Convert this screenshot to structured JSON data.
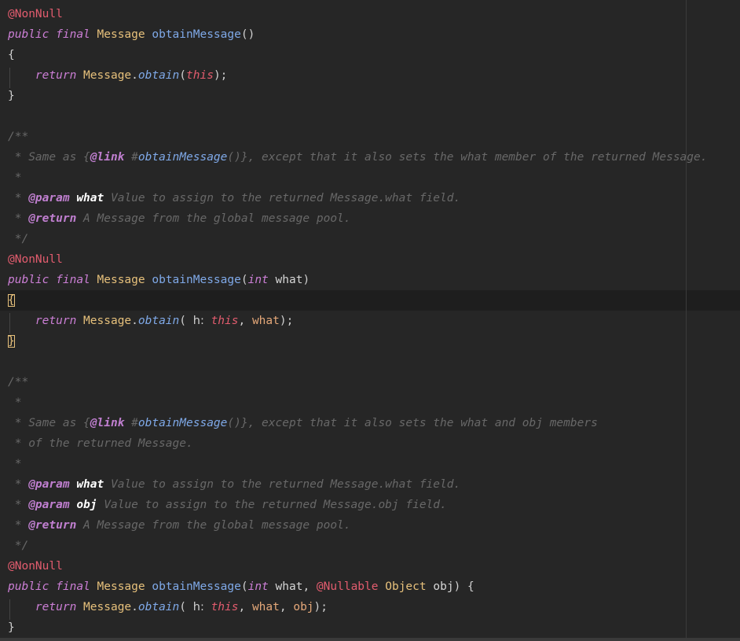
{
  "editor": {
    "lines": [
      [
        {
          "t": "@NonNull",
          "c": "annot"
        }
      ],
      [
        {
          "t": "public",
          "c": "kw"
        },
        {
          "t": " "
        },
        {
          "t": "final",
          "c": "kw"
        },
        {
          "t": " "
        },
        {
          "t": "Message",
          "c": "type"
        },
        {
          "t": " "
        },
        {
          "t": "obtainMessage",
          "c": "method"
        },
        {
          "t": "()",
          "c": "punc"
        }
      ],
      [
        {
          "t": "{",
          "c": "brace"
        }
      ],
      [
        {
          "t": "    "
        },
        {
          "t": "return",
          "c": "kw"
        },
        {
          "t": " "
        },
        {
          "t": "Message",
          "c": "type"
        },
        {
          "t": ".",
          "c": "punc"
        },
        {
          "t": "obtain",
          "c": "methodcall"
        },
        {
          "t": "(",
          "c": "punc"
        },
        {
          "t": "this",
          "c": "this"
        },
        {
          "t": ");",
          "c": "punc"
        }
      ],
      [
        {
          "t": "}",
          "c": "brace"
        }
      ],
      [],
      [
        {
          "t": "/**",
          "c": "comment"
        }
      ],
      [
        {
          "t": " * Same as {",
          "c": "comment"
        },
        {
          "t": "@link",
          "c": "doctag"
        },
        {
          "t": " #",
          "c": "comment"
        },
        {
          "t": "obtainMessage",
          "c": "doclink"
        },
        {
          "t": "()}, except that it also sets the what member of the returned Message.",
          "c": "comment"
        }
      ],
      [
        {
          "t": " *",
          "c": "comment"
        }
      ],
      [
        {
          "t": " * ",
          "c": "comment"
        },
        {
          "t": "@param",
          "c": "doctag"
        },
        {
          "t": " "
        },
        {
          "t": "what",
          "c": "docname"
        },
        {
          "t": " Value to assign to the returned Message.what field.",
          "c": "comment"
        }
      ],
      [
        {
          "t": " * ",
          "c": "comment"
        },
        {
          "t": "@return",
          "c": "doctag"
        },
        {
          "t": " A Message from the global message pool.",
          "c": "comment"
        }
      ],
      [
        {
          "t": " */",
          "c": "comment"
        }
      ],
      [
        {
          "t": "@NonNull",
          "c": "annot"
        }
      ],
      [
        {
          "t": "public",
          "c": "kw"
        },
        {
          "t": " "
        },
        {
          "t": "final",
          "c": "kw"
        },
        {
          "t": " "
        },
        {
          "t": "Message",
          "c": "type"
        },
        {
          "t": " "
        },
        {
          "t": "obtainMessage",
          "c": "method"
        },
        {
          "t": "(",
          "c": "punc"
        },
        {
          "t": "int",
          "c": "kw"
        },
        {
          "t": " "
        },
        {
          "t": "what",
          "c": "plain"
        },
        {
          "t": ")",
          "c": "punc"
        }
      ],
      [
        {
          "t": "{",
          "c": "matchbrace"
        }
      ],
      [
        {
          "t": "    "
        },
        {
          "t": "return",
          "c": "kw"
        },
        {
          "t": " "
        },
        {
          "t": "Message",
          "c": "type"
        },
        {
          "t": ".",
          "c": "punc"
        },
        {
          "t": "obtain",
          "c": "methodcall"
        },
        {
          "t": "( ",
          "c": "punc"
        },
        {
          "t": "h:",
          "c": "hint"
        },
        {
          "t": " "
        },
        {
          "t": "this",
          "c": "this"
        },
        {
          "t": ", ",
          "c": "punc"
        },
        {
          "t": "what",
          "c": "param"
        },
        {
          "t": ");",
          "c": "punc"
        }
      ],
      [
        {
          "t": "}",
          "c": "matchbrace"
        }
      ],
      [],
      [
        {
          "t": "/**",
          "c": "comment"
        }
      ],
      [
        {
          "t": " *",
          "c": "comment"
        }
      ],
      [
        {
          "t": " * Same as {",
          "c": "comment"
        },
        {
          "t": "@link",
          "c": "doctag"
        },
        {
          "t": " #",
          "c": "comment"
        },
        {
          "t": "obtainMessage",
          "c": "doclink"
        },
        {
          "t": "()}, except that it also sets the what and obj members",
          "c": "comment"
        }
      ],
      [
        {
          "t": " * of the returned Message.",
          "c": "comment"
        }
      ],
      [
        {
          "t": " *",
          "c": "comment"
        }
      ],
      [
        {
          "t": " * ",
          "c": "comment"
        },
        {
          "t": "@param",
          "c": "doctag"
        },
        {
          "t": " "
        },
        {
          "t": "what",
          "c": "docname"
        },
        {
          "t": " Value to assign to the returned Message.what field.",
          "c": "comment"
        }
      ],
      [
        {
          "t": " * ",
          "c": "comment"
        },
        {
          "t": "@param",
          "c": "doctag"
        },
        {
          "t": " "
        },
        {
          "t": "obj",
          "c": "docname"
        },
        {
          "t": " Value to assign to the returned Message.obj field.",
          "c": "comment"
        }
      ],
      [
        {
          "t": " * ",
          "c": "comment"
        },
        {
          "t": "@return",
          "c": "doctag"
        },
        {
          "t": " A Message from the global message pool.",
          "c": "comment"
        }
      ],
      [
        {
          "t": " */",
          "c": "comment"
        }
      ],
      [
        {
          "t": "@NonNull",
          "c": "annot"
        }
      ],
      [
        {
          "t": "public",
          "c": "kw"
        },
        {
          "t": " "
        },
        {
          "t": "final",
          "c": "kw"
        },
        {
          "t": " "
        },
        {
          "t": "Message",
          "c": "type"
        },
        {
          "t": " "
        },
        {
          "t": "obtainMessage",
          "c": "method"
        },
        {
          "t": "(",
          "c": "punc"
        },
        {
          "t": "int",
          "c": "kw"
        },
        {
          "t": " "
        },
        {
          "t": "what",
          "c": "plain"
        },
        {
          "t": ", ",
          "c": "punc"
        },
        {
          "t": "@Nullable",
          "c": "annot"
        },
        {
          "t": " "
        },
        {
          "t": "Object",
          "c": "type"
        },
        {
          "t": " "
        },
        {
          "t": "obj",
          "c": "plain"
        },
        {
          "t": ") {",
          "c": "punc"
        }
      ],
      [
        {
          "t": "    "
        },
        {
          "t": "return",
          "c": "kw"
        },
        {
          "t": " "
        },
        {
          "t": "Message",
          "c": "type"
        },
        {
          "t": ".",
          "c": "punc"
        },
        {
          "t": "obtain",
          "c": "methodcall"
        },
        {
          "t": "( ",
          "c": "punc"
        },
        {
          "t": "h:",
          "c": "hint"
        },
        {
          "t": " "
        },
        {
          "t": "this",
          "c": "this"
        },
        {
          "t": ", ",
          "c": "punc"
        },
        {
          "t": "what",
          "c": "param"
        },
        {
          "t": ", ",
          "c": "punc"
        },
        {
          "t": "obj",
          "c": "param"
        },
        {
          "t": ");",
          "c": "punc"
        }
      ],
      [
        {
          "t": "}",
          "c": "brace"
        }
      ]
    ]
  },
  "colors": {
    "background": "#262626",
    "current_line": "#1e1e1e",
    "annotation": "#e25c6e",
    "keyword": "#cc7fd6",
    "type": "#e6c07b",
    "method": "#7fa9e8",
    "parameter": "#e5a879",
    "comment": "#686868",
    "doc_tag": "#c07fd0"
  }
}
